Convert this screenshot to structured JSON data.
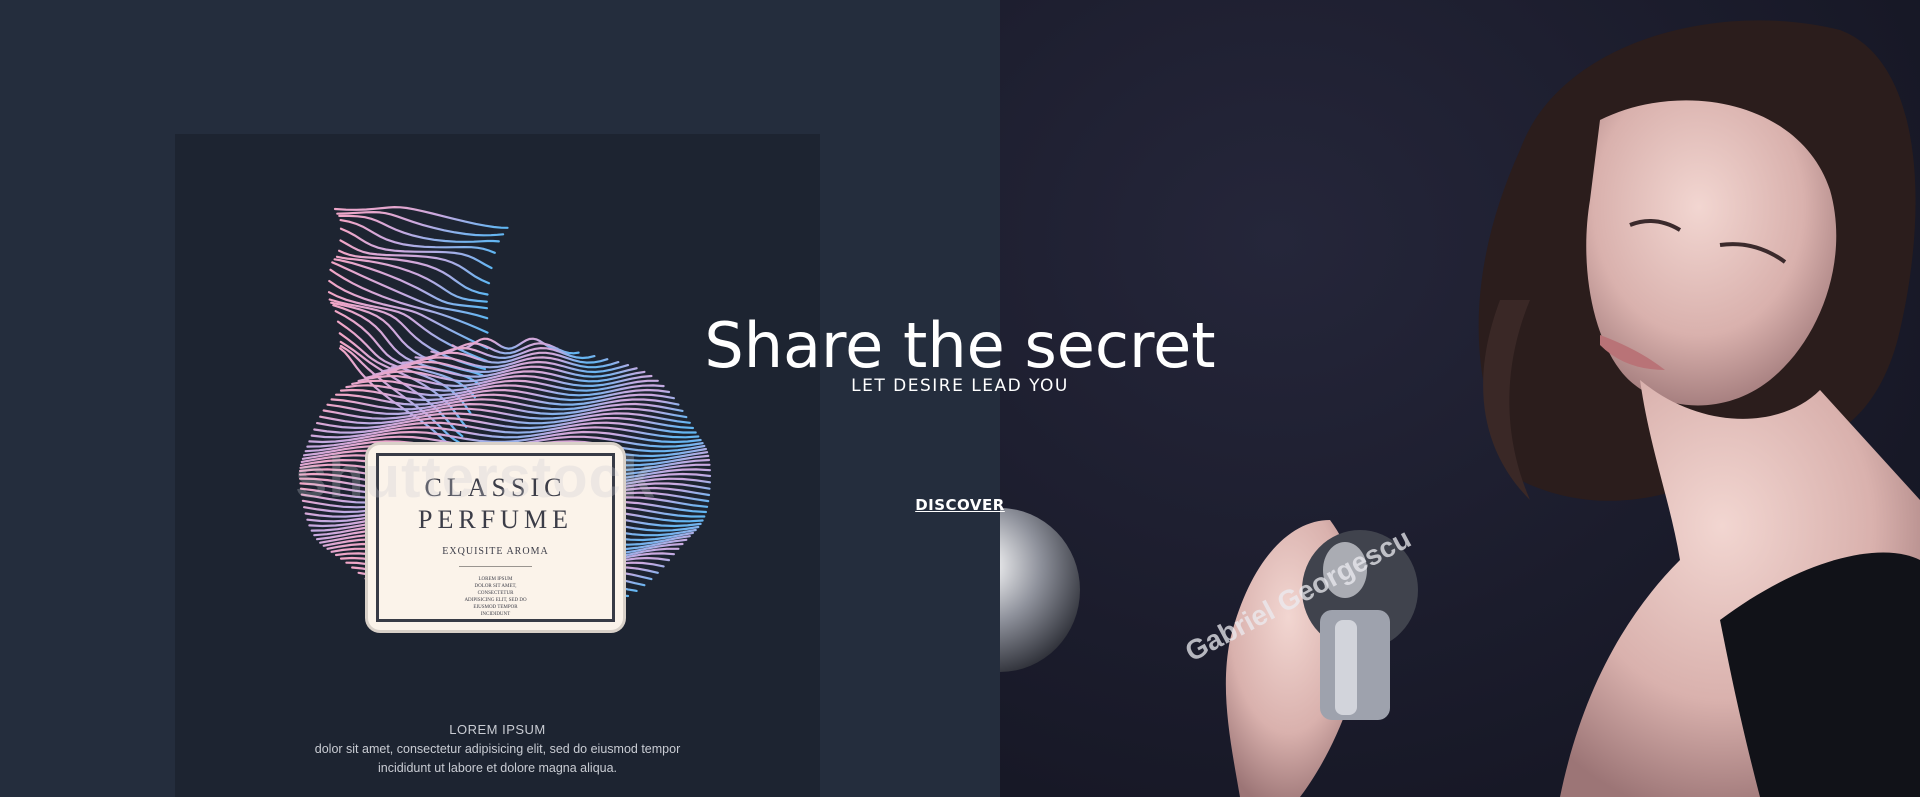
{
  "hero": {
    "headline": "Share the secret",
    "tagline": "LET DESIRE LEAD YOU",
    "cta_label": "DISCOVER"
  },
  "promo_card": {
    "label_title_line1": "CLASSIC",
    "label_title_line2": "PERFUME",
    "label_subtitle": "EXQUISITE AROMA",
    "label_small_text": "LOREM IPSUM\nDOLOR SIT AMET,\nCONSECTETUR\nADIPISICING ELIT, SED DO\nEIUSMOD TEMPOR\nINCIDIDUNT",
    "watermark": "shutterstock",
    "footer_title": "LOREM IPSUM",
    "footer_text": "dolor sit amet, consectetur adipisicing elit, sed do eiusmod tempor\nincididunt ut labore et dolore magna aliqua."
  },
  "photo": {
    "watermark": "Gabriel Georgescu"
  },
  "colors": {
    "left_bg": "#242d3d",
    "right_bg": "#1a1b2b",
    "text": "#ffffff"
  }
}
